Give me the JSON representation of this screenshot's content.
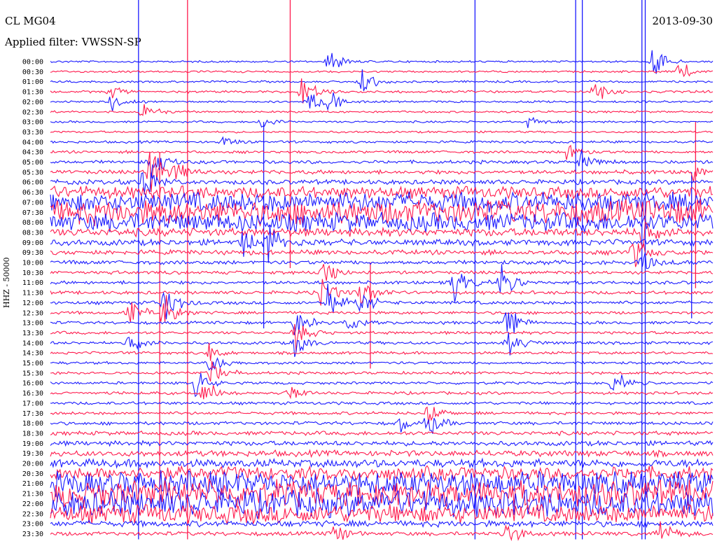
{
  "header": {
    "station": "CL MG04",
    "filter": "Applied filter: VWSSN-SP",
    "date": "2013-09-30"
  },
  "y_axis_label": "HHZ - 50000",
  "colors": {
    "trace_a": "#1a1aff",
    "trace_b": "#ff1a4d",
    "background": "#ffffff"
  },
  "chart_data": {
    "type": "helicorder",
    "rows": [
      "00:00",
      "00:30",
      "01:00",
      "01:30",
      "02:00",
      "02:30",
      "03:00",
      "03:30",
      "04:00",
      "04:30",
      "05:00",
      "05:30",
      "06:00",
      "06:30",
      "07:00",
      "07:30",
      "08:00",
      "08:30",
      "09:00",
      "09:30",
      "10:00",
      "10:30",
      "11:00",
      "11:30",
      "12:00",
      "12:30",
      "13:00",
      "13:30",
      "14:00",
      "14:30",
      "15:00",
      "15:30",
      "16:00",
      "16:30",
      "17:00",
      "17:30",
      "18:00",
      "18:30",
      "19:00",
      "19:30",
      "20:00",
      "20:30",
      "21:00",
      "21:30",
      "22:00",
      "22:30",
      "23:00",
      "23:30"
    ],
    "row_noise": [
      0.15,
      0.15,
      0.15,
      0.18,
      0.15,
      0.15,
      0.15,
      0.15,
      0.18,
      0.2,
      0.25,
      0.3,
      0.35,
      0.9,
      1.5,
      1.8,
      1.4,
      0.6,
      0.45,
      0.35,
      0.3,
      0.25,
      0.25,
      0.25,
      0.25,
      0.22,
      0.22,
      0.22,
      0.22,
      0.2,
      0.2,
      0.2,
      0.2,
      0.22,
      0.22,
      0.22,
      0.25,
      0.3,
      0.35,
      0.45,
      0.6,
      1.0,
      1.8,
      2.0,
      2.0,
      1.4,
      0.45,
      0.3
    ],
    "events": [
      {
        "row": 0,
        "pos": 0.42,
        "amp": 2.0
      },
      {
        "row": 0,
        "pos": 0.91,
        "amp": 2.5
      },
      {
        "row": 1,
        "pos": 0.95,
        "amp": 1.5
      },
      {
        "row": 2,
        "pos": 0.47,
        "amp": 2.5
      },
      {
        "row": 3,
        "pos": 0.38,
        "amp": 2.5
      },
      {
        "row": 3,
        "pos": 0.82,
        "amp": 2.2
      },
      {
        "row": 3,
        "pos": 0.09,
        "amp": 1.2
      },
      {
        "row": 4,
        "pos": 0.09,
        "amp": 1.5
      },
      {
        "row": 4,
        "pos": 0.39,
        "amp": 2.0
      },
      {
        "row": 4,
        "pos": 0.42,
        "amp": 1.5
      },
      {
        "row": 5,
        "pos": 0.14,
        "amp": 2.0
      },
      {
        "row": 6,
        "pos": 0.72,
        "amp": 1.2
      },
      {
        "row": 6,
        "pos": 0.32,
        "amp": 1.2
      },
      {
        "row": 8,
        "pos": 0.26,
        "amp": 1.0
      },
      {
        "row": 9,
        "pos": 0.78,
        "amp": 2.0
      },
      {
        "row": 10,
        "pos": 0.15,
        "amp": 3.5
      },
      {
        "row": 10,
        "pos": 0.8,
        "amp": 1.5
      },
      {
        "row": 11,
        "pos": 0.15,
        "amp": 4.0
      },
      {
        "row": 11,
        "pos": 0.19,
        "amp": 1.5
      },
      {
        "row": 11,
        "pos": 0.97,
        "amp": 1.5
      },
      {
        "row": 12,
        "pos": 0.14,
        "amp": 3.0
      },
      {
        "row": 17,
        "pos": 0.89,
        "amp": 2.0
      },
      {
        "row": 18,
        "pos": 0.29,
        "amp": 2.0
      },
      {
        "row": 18,
        "pos": 0.33,
        "amp": 2.5
      },
      {
        "row": 19,
        "pos": 0.88,
        "amp": 2.5
      },
      {
        "row": 20,
        "pos": 0.89,
        "amp": 2.0
      },
      {
        "row": 21,
        "pos": 0.41,
        "amp": 2.5
      },
      {
        "row": 22,
        "pos": 0.61,
        "amp": 3.0
      },
      {
        "row": 22,
        "pos": 0.68,
        "amp": 3.0
      },
      {
        "row": 23,
        "pos": 0.41,
        "amp": 2.5
      },
      {
        "row": 23,
        "pos": 0.47,
        "amp": 2.5
      },
      {
        "row": 24,
        "pos": 0.42,
        "amp": 3.0
      },
      {
        "row": 24,
        "pos": 0.47,
        "amp": 2.5
      },
      {
        "row": 24,
        "pos": 0.17,
        "amp": 4.0
      },
      {
        "row": 25,
        "pos": 0.12,
        "amp": 2.5
      },
      {
        "row": 25,
        "pos": 0.17,
        "amp": 3.5
      },
      {
        "row": 26,
        "pos": 0.37,
        "amp": 2.5
      },
      {
        "row": 26,
        "pos": 0.45,
        "amp": 1.5
      },
      {
        "row": 26,
        "pos": 0.69,
        "amp": 2.5
      },
      {
        "row": 27,
        "pos": 0.37,
        "amp": 2.5
      },
      {
        "row": 28,
        "pos": 0.12,
        "amp": 1.5
      },
      {
        "row": 28,
        "pos": 0.37,
        "amp": 2.0
      },
      {
        "row": 28,
        "pos": 0.69,
        "amp": 2.5
      },
      {
        "row": 29,
        "pos": 0.24,
        "amp": 1.5
      },
      {
        "row": 30,
        "pos": 0.24,
        "amp": 2.0
      },
      {
        "row": 31,
        "pos": 0.24,
        "amp": 2.5
      },
      {
        "row": 32,
        "pos": 0.22,
        "amp": 2.0
      },
      {
        "row": 32,
        "pos": 0.85,
        "amp": 2.0
      },
      {
        "row": 33,
        "pos": 0.23,
        "amp": 2.5
      },
      {
        "row": 33,
        "pos": 0.36,
        "amp": 1.5
      },
      {
        "row": 35,
        "pos": 0.57,
        "amp": 2.0
      },
      {
        "row": 36,
        "pos": 0.53,
        "amp": 1.5
      },
      {
        "row": 36,
        "pos": 0.57,
        "amp": 2.5
      },
      {
        "row": 47,
        "pos": 0.43,
        "amp": 1.5
      },
      {
        "row": 47,
        "pos": 0.69,
        "amp": 2.0
      },
      {
        "row": 47,
        "pos": 0.92,
        "amp": 2.0
      }
    ],
    "vertical_spikes": [
      {
        "pos": 0.133,
        "top_row": -1,
        "bottom_row": 47,
        "color": "a"
      },
      {
        "pos": 0.165,
        "top_row": 9,
        "bottom_row": 45,
        "color": "b"
      },
      {
        "pos": 0.207,
        "top_row": -1,
        "bottom_row": 47,
        "color": "b"
      },
      {
        "pos": 0.362,
        "top_row": -1,
        "bottom_row": 20,
        "color": "b"
      },
      {
        "pos": 0.641,
        "top_row": -1,
        "bottom_row": 47,
        "color": "a"
      },
      {
        "pos": 0.793,
        "top_row": -1,
        "bottom_row": 47,
        "color": "a"
      },
      {
        "pos": 0.803,
        "top_row": -1,
        "bottom_row": 47,
        "color": "a"
      },
      {
        "pos": 0.893,
        "top_row": -1,
        "bottom_row": 47,
        "color": "a"
      },
      {
        "pos": 0.898,
        "top_row": -1,
        "bottom_row": 47,
        "color": "a"
      },
      {
        "pos": 0.322,
        "top_row": 6,
        "bottom_row": 26,
        "color": "a"
      },
      {
        "pos": 0.483,
        "top_row": 20,
        "bottom_row": 30,
        "color": "b"
      },
      {
        "pos": 0.968,
        "top_row": 11,
        "bottom_row": 25,
        "color": "a"
      },
      {
        "pos": 0.974,
        "top_row": 6,
        "bottom_row": 22,
        "color": "b"
      }
    ]
  }
}
